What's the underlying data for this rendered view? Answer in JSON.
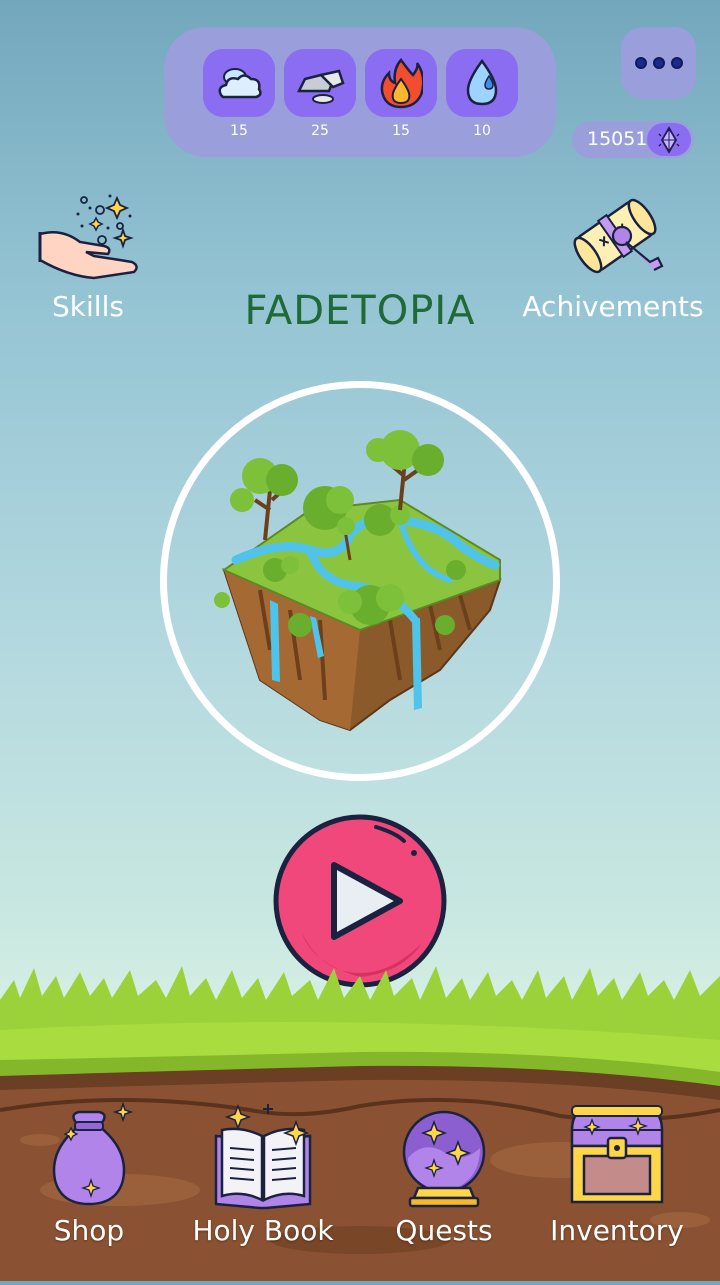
{
  "app": {
    "title": "FADETOPIA"
  },
  "resources": [
    {
      "icon": "cloud-icon",
      "value": "15"
    },
    {
      "icon": "rock-icon",
      "value": "25"
    },
    {
      "icon": "fire-icon",
      "value": "15"
    },
    {
      "icon": "water-drop-icon",
      "value": "10"
    }
  ],
  "currency": {
    "amount": "15051",
    "icon": "gem-icon"
  },
  "top_menu": {
    "skills_label": "Skills",
    "achievements_label": "Achivements"
  },
  "bottom_nav": {
    "shop_label": "Shop",
    "holy_book_label": "Holy Book",
    "quests_label": "Quests",
    "inventory_label": "Inventory"
  },
  "colors": {
    "accent_purple": "#8a6df0",
    "panel_lilac": "#9a9fdc",
    "play_red": "#f0487a",
    "title_green": "#1f6a37"
  }
}
